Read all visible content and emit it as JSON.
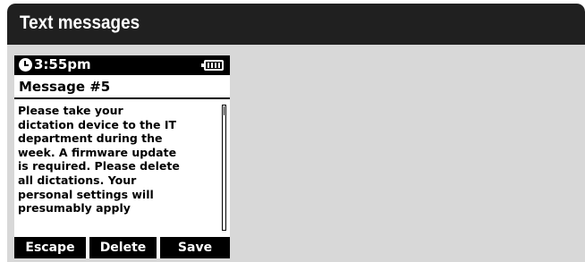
{
  "window": {
    "title": "Text messages"
  },
  "status_bar": {
    "time": "3:55pm",
    "clock_icon": "clock-icon",
    "battery_icon": "battery-icon"
  },
  "message": {
    "title": "Message #5",
    "lines": [
      "Please take your",
      "dictation device to the IT",
      "department during the",
      "week. A firmware update",
      "is required. Please delete",
      "all dictations. Your",
      "personal settings will",
      "presumably apply"
    ],
    "scroll_position": 0
  },
  "softkeys": {
    "escape": "Escape",
    "delete": "Delete",
    "save": "Save"
  },
  "colors": {
    "titlebar": "#202020",
    "background": "#d8d8d8",
    "screen": "#ffffff",
    "ink": "#000000"
  }
}
